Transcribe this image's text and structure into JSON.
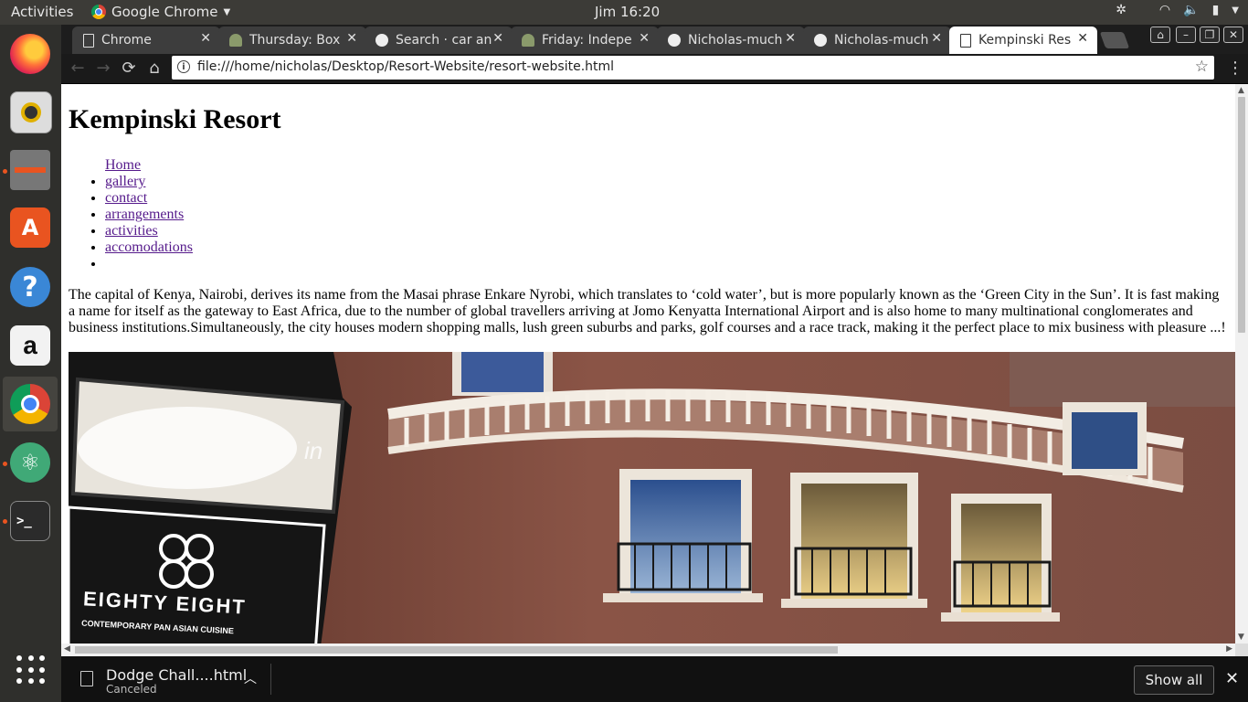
{
  "topbar": {
    "activities": "Activities",
    "app_menu": "Google Chrome",
    "clock": "Jim 16:20"
  },
  "tabs": [
    {
      "label": "Chrome",
      "icon": "page-icon"
    },
    {
      "label": "Thursday: Box",
      "icon": "tree-icon"
    },
    {
      "label": "Search · car an",
      "icon": "github-icon"
    },
    {
      "label": "Friday: Indepe",
      "icon": "tree-icon"
    },
    {
      "label": "Nicholas-much",
      "icon": "github-icon"
    },
    {
      "label": "Nicholas-much",
      "icon": "github-icon"
    },
    {
      "label": "Kempinski Res",
      "icon": "page-icon",
      "active": true
    }
  ],
  "address": {
    "url": "file:///home/nicholas/Desktop/Resort-Website/resort-website.html"
  },
  "page": {
    "title": "Kempinski Resort",
    "nav": [
      "Home",
      "gallery",
      "contact",
      "arrangements",
      "activities",
      "accomodations"
    ],
    "intro": "The capital of Kenya, Nairobi, derives its name from the Masai phrase Enkare Nyrobi, which translates to ‘cold water’, but is more popularly known as the ‘Green City in the Sun’. It is fast making a name for itself as the gateway to East Africa, due to the number of global travellers arriving at Jomo Kenyatta International Airport and is also home to many multinational conglomerates and business institutions.Simultaneously, the city houses modern shopping malls, lush green suburbs and parks, golf courses and a race track, making it the perfect place to mix business with pleasure ...!",
    "sign_brand": "EIGHTY EIGHT",
    "sign_tagline": "CONTEMPORARY PAN ASIAN CUISINE",
    "sign_fragment": "in"
  },
  "downloads": {
    "filename": "Dodge Chall....html",
    "status": "Canceled",
    "show_all": "Show all"
  },
  "colors": {
    "link": "#551a8b",
    "dock_active_dot": "#e95420"
  }
}
